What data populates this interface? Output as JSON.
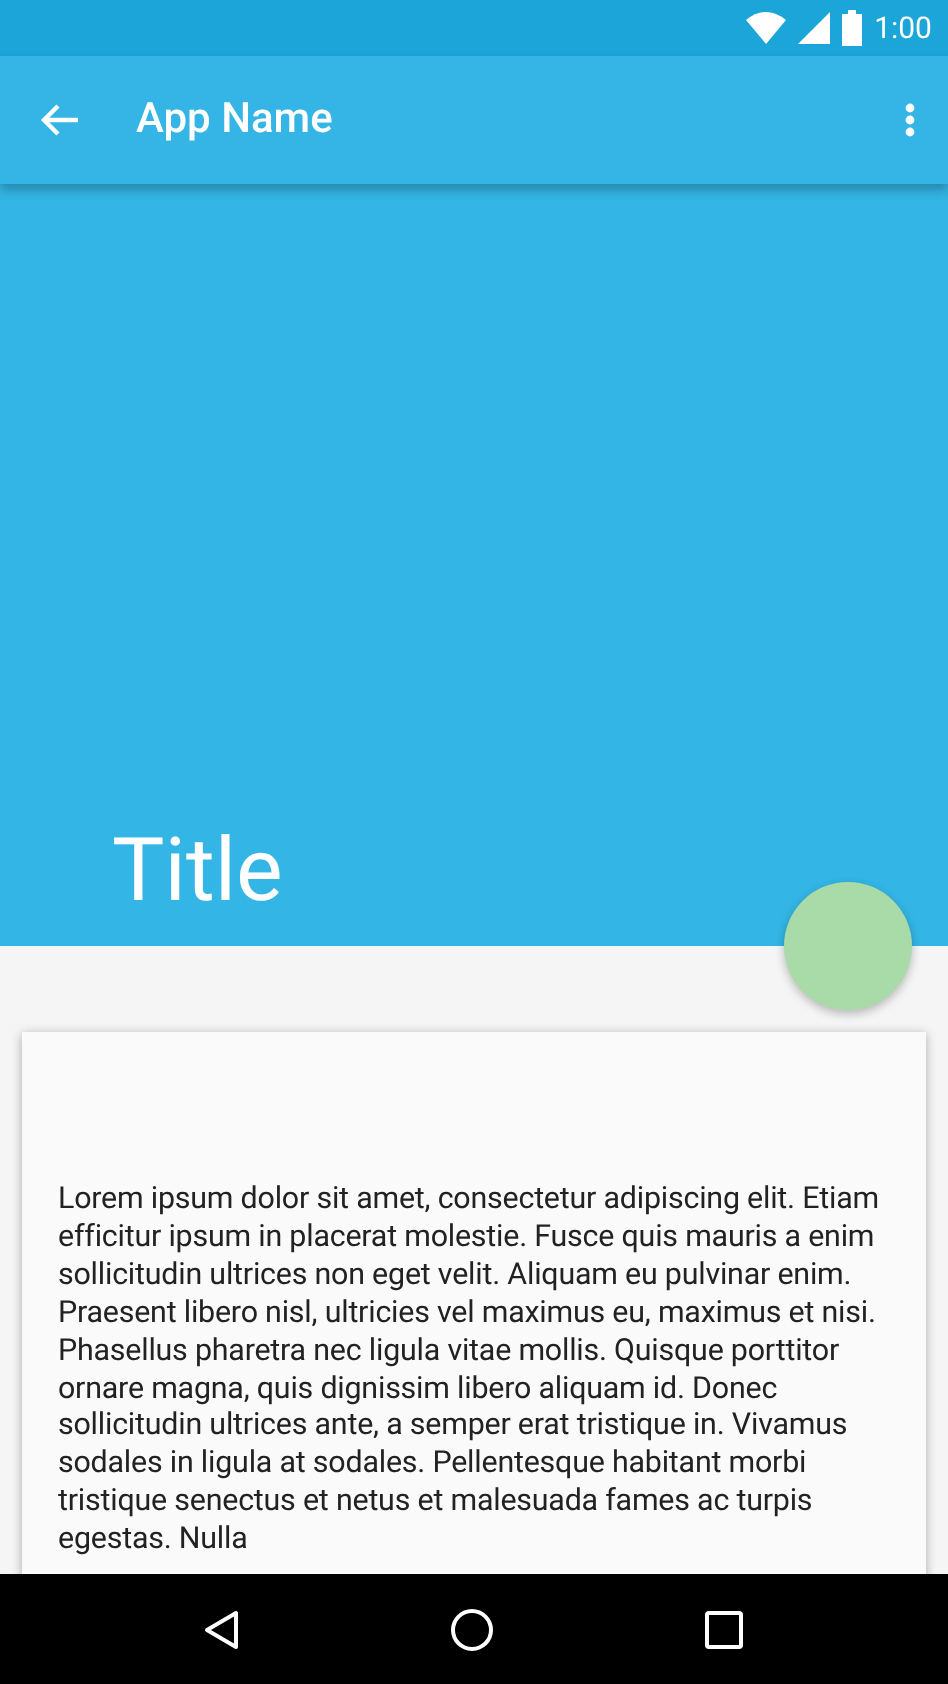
{
  "status_bar": {
    "time": "1:00"
  },
  "app_bar": {
    "title": "App Name"
  },
  "header": {
    "title": "Title"
  },
  "card": {
    "body": "Lorem ipsum dolor sit amet, consectetur adipiscing elit. Etiam efficitur ipsum in placerat molestie. Fusce quis mauris a enim sollicitudin ultrices non eget velit. Aliquam eu pulvinar enim. Praesent libero nisl, ultricies vel maximus eu, maximus et nisi. Phasellus pharetra nec ligula vitae mollis. Quisque porttitor ornare magna, quis dignissim libero aliquam id. Donec sollicitudin ultrices ante, a semper erat tristique in. Vivamus sodales in ligula at sodales. Pellentesque habitant morbi tristique senectus et netus et malesuada fames ac turpis egestas. Nulla"
  }
}
